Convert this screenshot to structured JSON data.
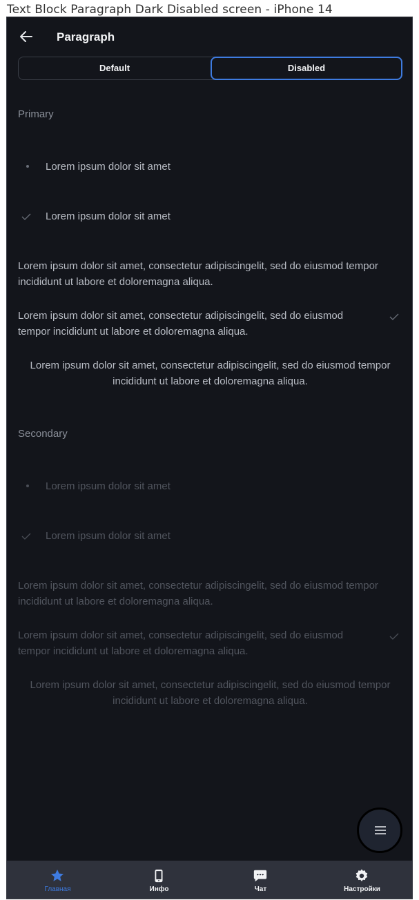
{
  "frame": {
    "title": "Text Block Paragraph Dark Disabled screen - iPhone 14"
  },
  "header": {
    "title": "Paragraph",
    "back_icon": "arrow-left-icon"
  },
  "segmented": {
    "options": [
      "Default",
      "Disabled"
    ],
    "selected": "Disabled"
  },
  "primary": {
    "title": "Primary",
    "bullet_text": "Lorem ipsum dolor sit amet",
    "check_text": "Lorem ipsum dolor sit amet",
    "paragraph_line1": "Lorem ipsum dolor sit amet, consectetur adipiscingelit, sed do eiusmod tempor",
    "paragraph_line2": "incididunt ut labore et doloremagna aliqua.",
    "check_paragraph_line1": "Lorem ipsum dolor sit amet, consectetur adipiscingelit, sed do eiusmod",
    "check_paragraph_line2": "tempor incididunt ut labore et doloremagna aliqua.",
    "center_line1": "Lorem ipsum dolor sit amet, consectetur adipiscingelit, sed do eiusmod tempor",
    "center_line2": "incididunt ut labore et doloremagna aliqua."
  },
  "secondary": {
    "title": "Secondary",
    "bullet_text": "Lorem ipsum dolor sit amet",
    "check_text": "Lorem ipsum dolor sit amet",
    "paragraph_line1": "Lorem ipsum dolor sit amet, consectetur adipiscingelit, sed do eiusmod tempor",
    "paragraph_line2": "incididunt ut labore et doloremagna aliqua.",
    "check_paragraph_line1": "Lorem ipsum dolor sit amet, consectetur adipiscingelit, sed do eiusmod",
    "check_paragraph_line2": "tempor incididunt ut labore et doloremagna aliqua.",
    "center_line1": "Lorem ipsum dolor sit amet, consectetur adipiscingelit, sed do eiusmod tempor",
    "center_line2": "incididunt ut labore et doloremagna aliqua."
  },
  "fab": {
    "icon": "menu-icon"
  },
  "tabbar": {
    "items": [
      {
        "label": "Главная",
        "icon": "star-icon",
        "active": true
      },
      {
        "label": "Инфо",
        "icon": "phone-icon",
        "active": false
      },
      {
        "label": "Чат",
        "icon": "chat-icon",
        "active": false
      },
      {
        "label": "Настройки",
        "icon": "gear-icon",
        "active": false
      }
    ]
  },
  "colors": {
    "accent": "#3e7be0",
    "background": "#13151b",
    "tabbar": "#2f323c",
    "primary_text": "#b8bcc4",
    "secondary_text": "#51555e"
  }
}
